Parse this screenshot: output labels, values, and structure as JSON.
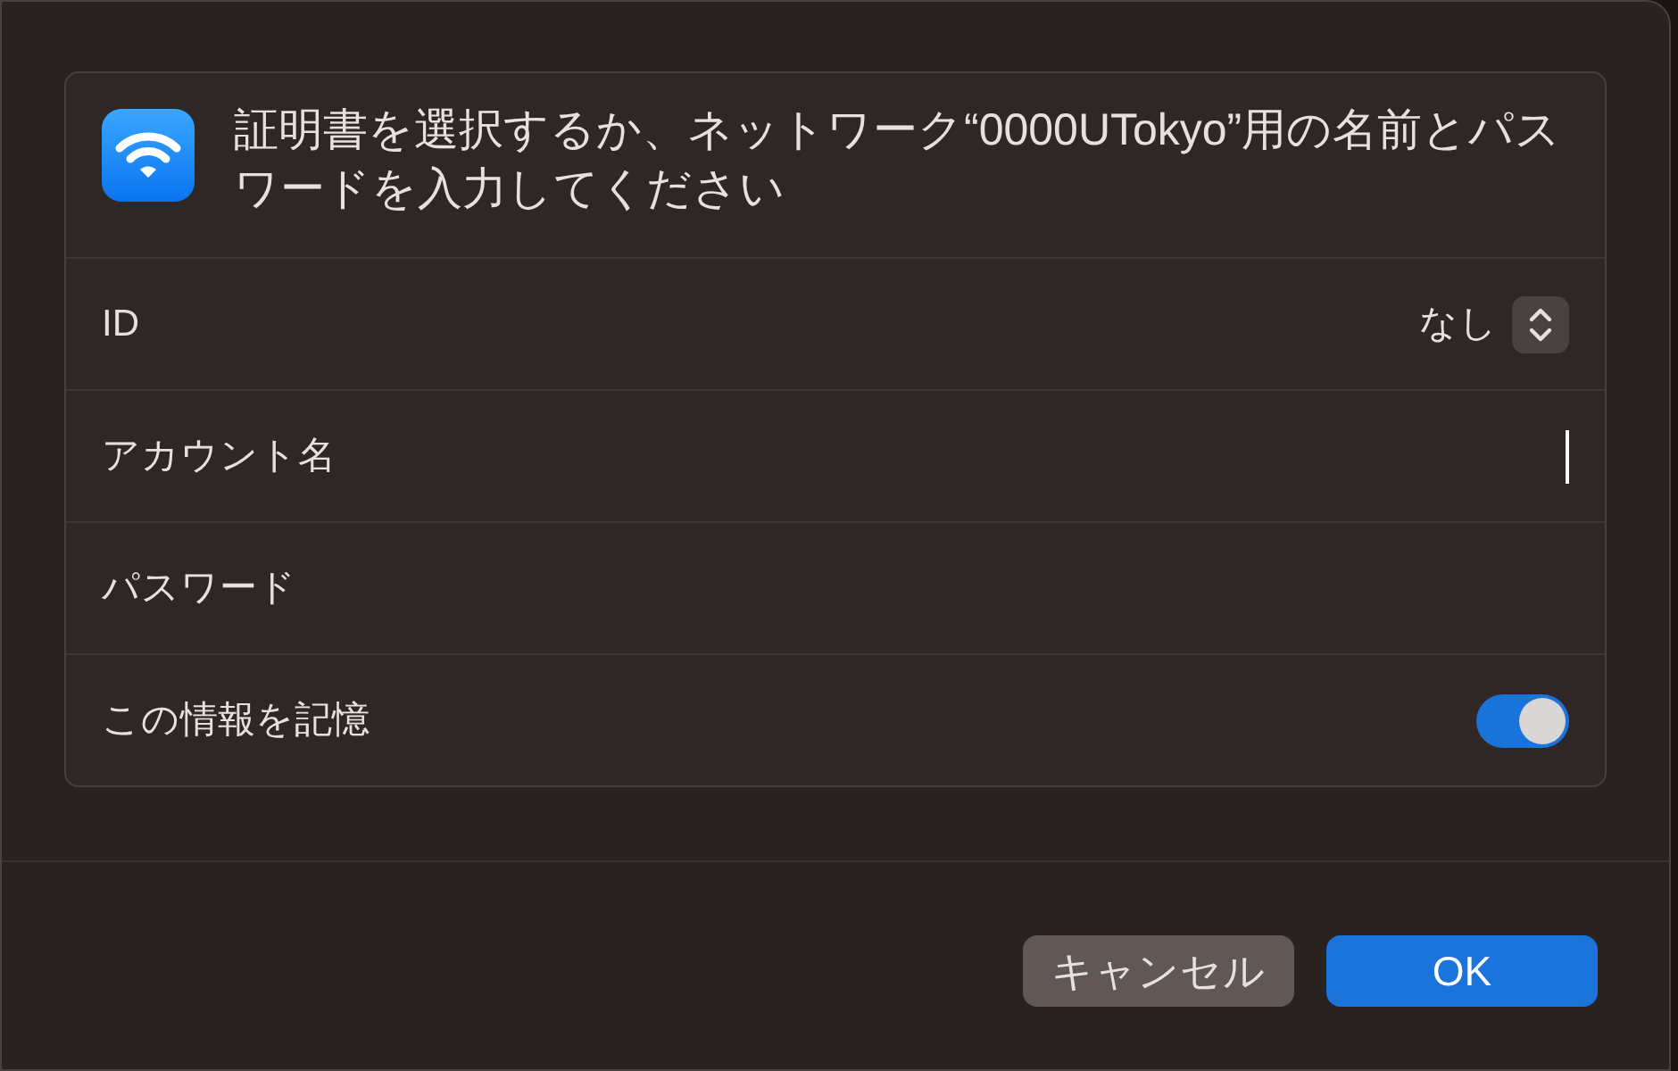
{
  "header": {
    "message": "証明書を選択するか、ネットワーク“0000UTokyo”用の名前とパスワードを入力してください"
  },
  "rows": [
    {
      "kind": "popup",
      "label": "ID",
      "value": "なし"
    },
    {
      "kind": "text",
      "label": "アカウント名",
      "focused": true
    },
    {
      "kind": "text",
      "label": "パスワード"
    },
    {
      "kind": "toggle",
      "label": "この情報を記憶",
      "on": true
    }
  ],
  "buttons": [
    {
      "label": "キャンセル",
      "kind": "secondary"
    },
    {
      "label": "OK",
      "kind": "primary"
    }
  ]
}
